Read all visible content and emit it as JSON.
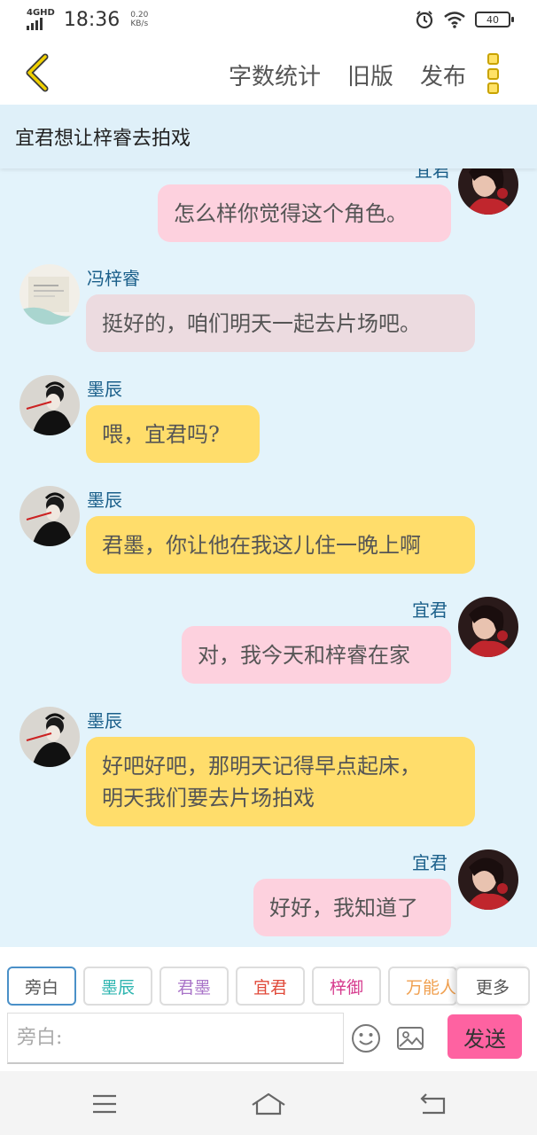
{
  "status_bar": {
    "network": "4GHD",
    "time": "18:36",
    "speed_value": "0.20",
    "speed_unit": "KB/s",
    "battery": "40"
  },
  "top_bar": {
    "word_count_label": "字数统计",
    "old_version_label": "旧版",
    "publish_label": "发布"
  },
  "chat": {
    "title": "宜君想让梓睿去拍戏",
    "messages": [
      {
        "sender": "宜君",
        "text": "怎么样你觉得这个角色。",
        "side": "right",
        "color": "pink"
      },
      {
        "sender": "冯梓睿",
        "text": "挺好的，咱们明天一起去片场吧。",
        "side": "left",
        "color": "gray"
      },
      {
        "sender": "墨辰",
        "text": "喂，宜君吗?",
        "side": "left",
        "color": "yellow"
      },
      {
        "sender": "墨辰",
        "text": "君墨，你让他在我这儿住一晚上啊",
        "side": "left",
        "color": "yellow"
      },
      {
        "sender": "宜君",
        "text": "对，我今天和梓睿在家",
        "side": "right",
        "color": "pink"
      },
      {
        "sender": "墨辰",
        "text_line1": "好吧好吧，那明天记得早点起床，",
        "text_line2": "明天我们要去片场拍戏",
        "side": "left",
        "color": "yellow"
      },
      {
        "sender": "宜君",
        "text": "好好，我知道了",
        "side": "right",
        "color": "pink"
      }
    ]
  },
  "roles": [
    {
      "label": "旁白",
      "color": "#555555"
    },
    {
      "label": "墨辰",
      "color": "#2eb5b0"
    },
    {
      "label": "君墨",
      "color": "#a974c8"
    },
    {
      "label": "宜君",
      "color": "#e04a3a"
    },
    {
      "label": "梓御",
      "color": "#d63b8e"
    },
    {
      "label": "万能人",
      "color": "#f0a050"
    }
  ],
  "more_label": "更多",
  "input": {
    "placeholder": "旁白:"
  },
  "send_label": "发送",
  "colors": {
    "chat_bg": "#e3f3fb",
    "pink_bubble": "#fdd1de",
    "yellow_bubble": "#ffdd6b",
    "gray_bubble": "#ecdbe0",
    "send_button": "#fe62a1",
    "sender_name": "#1a5f8a",
    "back_arrow": "#f0c000"
  },
  "icons": {
    "back": "chevron-left-icon",
    "menu": "more-vertical-icon",
    "emoji": "emoji-icon",
    "image": "image-icon",
    "nav_menu": "menu-icon",
    "nav_home": "home-icon",
    "nav_back": "back-icon"
  }
}
